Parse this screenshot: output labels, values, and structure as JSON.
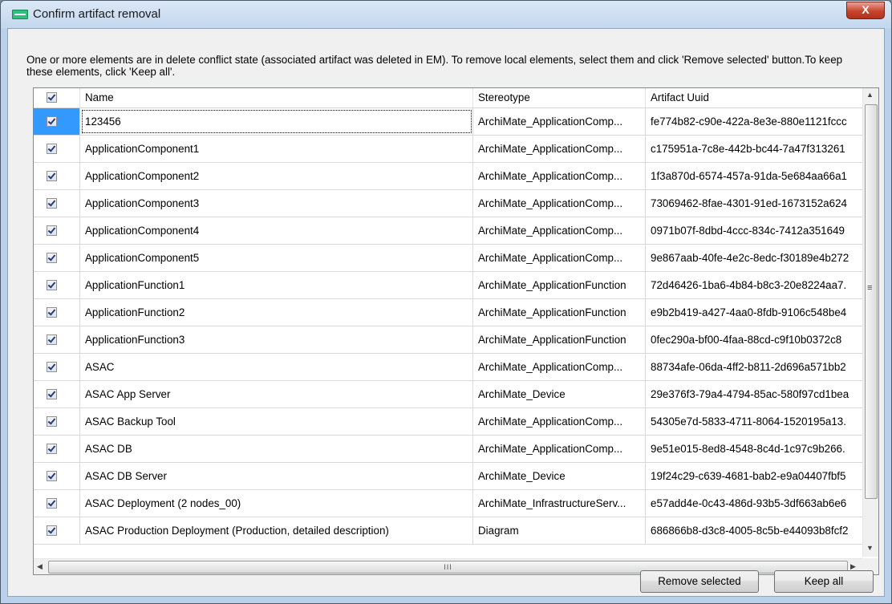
{
  "window": {
    "title": "Confirm artifact removal",
    "close_glyph": "X"
  },
  "message": "One or more elements are in delete conflict state (associated artifact was deleted in EM). To remove local elements, select them and click 'Remove selected' button.To keep these elements, click 'Keep all'.",
  "table": {
    "header_checked": true,
    "columns": [
      "Name",
      "Stereotype",
      "Artifact Uuid"
    ],
    "rows": [
      {
        "checked": true,
        "name": "123456",
        "stereotype": "ArchiMate_ApplicationComp...",
        "uuid": "fe774b82-c90e-422a-8e3e-880e1121fccc"
      },
      {
        "checked": true,
        "name": "ApplicationComponent1",
        "stereotype": "ArchiMate_ApplicationComp...",
        "uuid": "c175951a-7c8e-442b-bc44-7a47f313261"
      },
      {
        "checked": true,
        "name": "ApplicationComponent2",
        "stereotype": "ArchiMate_ApplicationComp...",
        "uuid": "1f3a870d-6574-457a-91da-5e684aa66a1"
      },
      {
        "checked": true,
        "name": "ApplicationComponent3",
        "stereotype": "ArchiMate_ApplicationComp...",
        "uuid": "73069462-8fae-4301-91ed-1673152a624"
      },
      {
        "checked": true,
        "name": "ApplicationComponent4",
        "stereotype": "ArchiMate_ApplicationComp...",
        "uuid": "0971b07f-8dbd-4ccc-834c-7412a351649"
      },
      {
        "checked": true,
        "name": "ApplicationComponent5",
        "stereotype": "ArchiMate_ApplicationComp...",
        "uuid": "9e867aab-40fe-4e2c-8edc-f30189e4b272"
      },
      {
        "checked": true,
        "name": "ApplicationFunction1",
        "stereotype": "ArchiMate_ApplicationFunction",
        "uuid": "72d46426-1ba6-4b84-b8c3-20e8224aa7."
      },
      {
        "checked": true,
        "name": "ApplicationFunction2",
        "stereotype": "ArchiMate_ApplicationFunction",
        "uuid": "e9b2b419-a427-4aa0-8fdb-9106c548be4"
      },
      {
        "checked": true,
        "name": "ApplicationFunction3",
        "stereotype": "ArchiMate_ApplicationFunction",
        "uuid": "0fec290a-bf00-4faa-88cd-c9f10b0372c8"
      },
      {
        "checked": true,
        "name": "ASAC",
        "stereotype": "ArchiMate_ApplicationComp...",
        "uuid": "88734afe-06da-4ff2-b811-2d696a571bb2"
      },
      {
        "checked": true,
        "name": "ASAC App Server",
        "stereotype": "ArchiMate_Device",
        "uuid": "29e376f3-79a4-4794-85ac-580f97cd1bea"
      },
      {
        "checked": true,
        "name": "ASAC Backup Tool",
        "stereotype": "ArchiMate_ApplicationComp...",
        "uuid": "54305e7d-5833-4711-8064-1520195a13."
      },
      {
        "checked": true,
        "name": "ASAC DB",
        "stereotype": "ArchiMate_ApplicationComp...",
        "uuid": "9e51e015-8ed8-4548-8c4d-1c97c9b266."
      },
      {
        "checked": true,
        "name": "ASAC DB Server",
        "stereotype": "ArchiMate_Device",
        "uuid": "19f24c29-c639-4681-bab2-e9a04407fbf5"
      },
      {
        "checked": true,
        "name": "ASAC Deployment (2 nodes_00)",
        "stereotype": "ArchiMate_InfrastructureServ...",
        "uuid": "e57add4e-0c43-486d-93b5-3df663ab6e6"
      },
      {
        "checked": true,
        "name": "ASAC Production Deployment (Production, detailed description)",
        "stereotype": "Diagram",
        "uuid": "686866b8-d3c8-4005-8c5b-e44093b8fcf2"
      }
    ]
  },
  "scrollbars": {
    "up_arrow": "▲",
    "down_arrow": "▼",
    "left_arrow": "◀",
    "right_arrow": "▶",
    "h_grip": "III",
    "v_grip": "≡"
  },
  "buttons": {
    "remove_label": "Remove selected",
    "keep_label": "Keep all"
  }
}
